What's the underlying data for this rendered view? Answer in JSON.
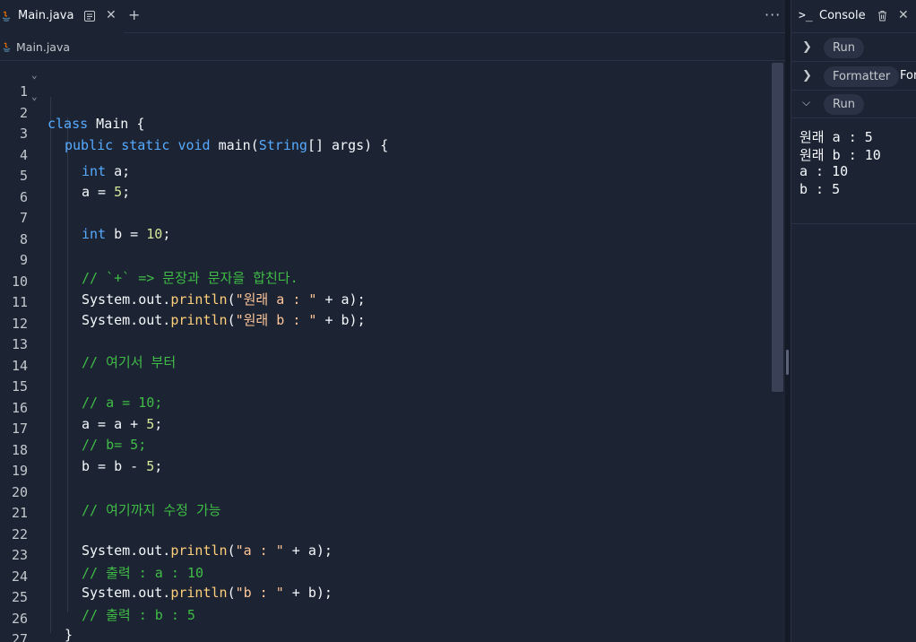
{
  "editor": {
    "tab": {
      "label": "Main.java"
    },
    "breadcrumb": "Main.java",
    "lines": [
      {
        "n": "1",
        "fold": true
      },
      {
        "n": "2",
        "fold": true
      },
      {
        "n": "3"
      },
      {
        "n": "4"
      },
      {
        "n": "5"
      },
      {
        "n": "6"
      },
      {
        "n": "7"
      },
      {
        "n": "8"
      },
      {
        "n": "9"
      },
      {
        "n": "10"
      },
      {
        "n": "11"
      },
      {
        "n": "12"
      },
      {
        "n": "13"
      },
      {
        "n": "14"
      },
      {
        "n": "15"
      },
      {
        "n": "16"
      },
      {
        "n": "17"
      },
      {
        "n": "18"
      },
      {
        "n": "19"
      },
      {
        "n": "20"
      },
      {
        "n": "21"
      },
      {
        "n": "22"
      },
      {
        "n": "23"
      },
      {
        "n": "24"
      },
      {
        "n": "25"
      },
      {
        "n": "26"
      },
      {
        "n": "27"
      }
    ],
    "code": {
      "l1": [
        "class",
        " Main {"
      ],
      "l2": [
        "public",
        " ",
        "static",
        " ",
        "void",
        " main(",
        "String",
        "[] args) {"
      ],
      "l4": [
        "int",
        " a;"
      ],
      "l5": [
        "a = ",
        "5",
        ";"
      ],
      "l7": [
        "int",
        " b = ",
        "10",
        ";"
      ],
      "l9": "// `+` => 문장과 문자을 합친다.",
      "l10": [
        "System.out.",
        "println",
        "(",
        "\"원래 a : \"",
        " + a);"
      ],
      "l11": [
        "System.out.",
        "println",
        "(",
        "\"원래 b : \"",
        " + b);"
      ],
      "l13": "// 여기서 부터",
      "l15": "// a = 10;",
      "l16": [
        "a = a + ",
        "5",
        ";"
      ],
      "l17": "// b= 5;",
      "l18": [
        "b = b - ",
        "5",
        ";"
      ],
      "l20": "// 여기까지 수정 가능",
      "l22": [
        "System.out.",
        "println",
        "(",
        "\"a : \"",
        " + a);"
      ],
      "l23": "// 출력 : a : 10",
      "l24": [
        "System.out.",
        "println",
        "(",
        "\"b : \"",
        " + b);"
      ],
      "l25": "// 출력 : b : 5",
      "l26": "}",
      "l27": "}"
    }
  },
  "console": {
    "prompt": ">_",
    "title": "Console",
    "rows": [
      {
        "chevron": ">",
        "pill": "Run"
      },
      {
        "chevron": ">",
        "pill": "Formatter",
        "extra": "For"
      },
      {
        "chevron": "v",
        "pill": "Run"
      }
    ],
    "output": [
      "원래 a : 5",
      "원래 b : 10",
      "a : 10",
      "b : 5"
    ]
  },
  "colors": {
    "background": "#1c2333",
    "keyword": "#57abff",
    "number": "#d6e79b",
    "string": "#ffc799",
    "comment": "#3fbd46",
    "function": "#ffcf7a"
  },
  "icons": [
    "java-icon",
    "document-icon",
    "close-icon",
    "plus-icon",
    "more-icon",
    "terminal-icon",
    "trash-icon",
    "chevron-right-icon",
    "chevron-down-icon"
  ]
}
